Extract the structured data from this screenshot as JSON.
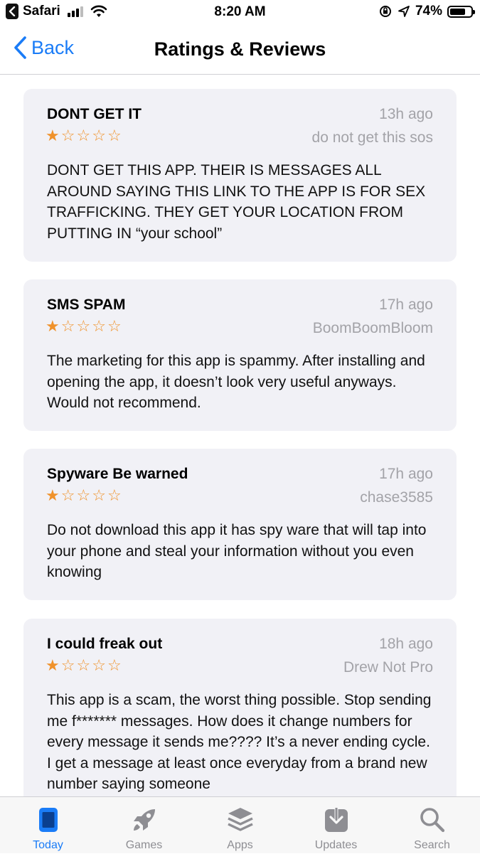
{
  "status_bar": {
    "back_app": "Safari",
    "time": "8:20 AM",
    "battery": "74%",
    "battery_level": 0.74
  },
  "nav": {
    "back_label": "Back",
    "title": "Ratings & Reviews"
  },
  "reviews": [
    {
      "title": "DONT GET IT",
      "date": "13h ago",
      "author": "do not get this sos",
      "rating": 1,
      "body": "DONT GET THIS APP. THEIR IS MESSAGES ALL AROUND SAYING THIS LINK TO THE APP IS FOR SEX TRAFFICKING. THEY GET YOUR LOCATION FROM PUTTING IN “your school”"
    },
    {
      "title": "SMS SPAM",
      "date": "17h ago",
      "author": "BoomBoomBloom",
      "rating": 1,
      "body": "The marketing for this app is spammy. After installing and opening the app, it doesn’t look very useful anyways. Would not recommend."
    },
    {
      "title": "Spyware Be warned",
      "date": "17h ago",
      "author": "chase3585",
      "rating": 1,
      "body": "Do not download this app it has spy ware that will tap into your phone and steal your information without you even knowing"
    },
    {
      "title": "I could freak out",
      "date": "18h ago",
      "author": "Drew Not Pro",
      "rating": 1,
      "body": "This app is a scam, the worst thing possible. Stop sending me f******* messages. How does it change numbers for every message it sends me???? It’s a never ending cycle. I get a message at least once everyday from a brand new number saying someone"
    }
  ],
  "tabs": [
    {
      "label": "Today",
      "icon": "today-icon",
      "active": true
    },
    {
      "label": "Games",
      "icon": "rocket-icon",
      "active": false
    },
    {
      "label": "Apps",
      "icon": "apps-stack-icon",
      "active": false
    },
    {
      "label": "Updates",
      "icon": "download-icon",
      "active": false
    },
    {
      "label": "Search",
      "icon": "search-icon",
      "active": false
    }
  ],
  "colors": {
    "accent": "#1a7cf7",
    "star": "#f0922b",
    "card": "#f1f1f6",
    "muted": "#a3a3a8"
  }
}
